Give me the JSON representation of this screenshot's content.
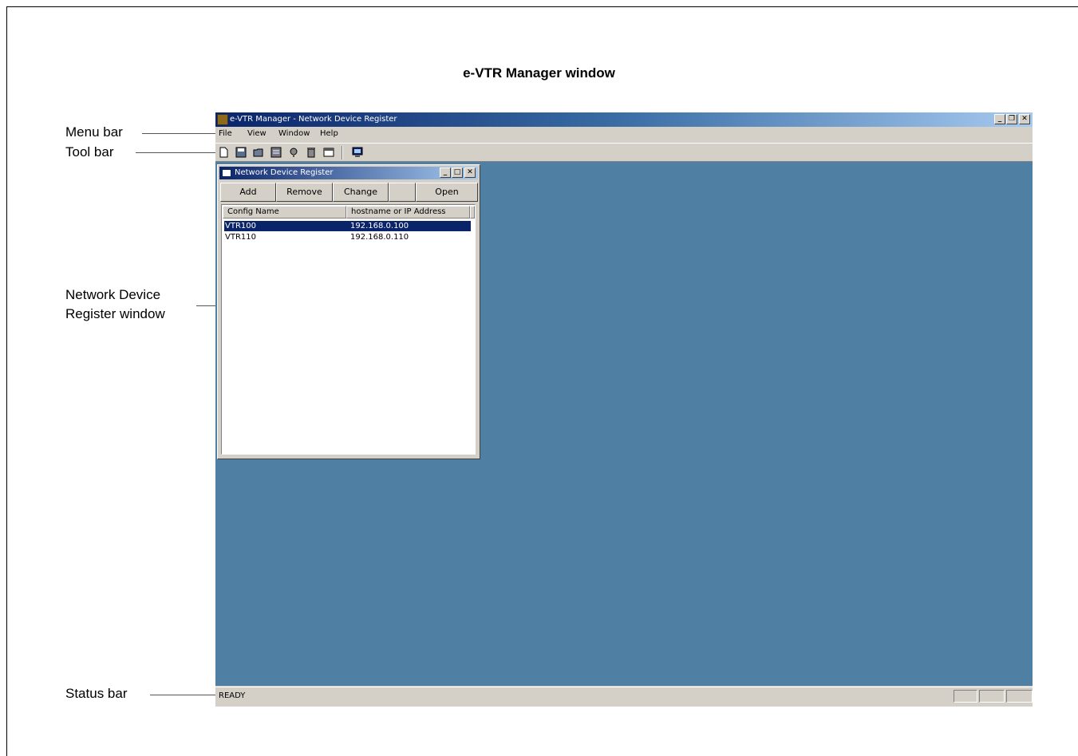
{
  "figure_title": "e-VTR Manager window",
  "callouts": {
    "menu_bar": "Menu bar",
    "tool_bar": "Tool bar",
    "ndr_window_line1": "Network Device",
    "ndr_window_line2": "Register window",
    "status_bar": "Status bar"
  },
  "app": {
    "title": "e-VTR Manager - Network Device Register",
    "window_buttons": {
      "minimize": "_",
      "restore": "❐",
      "close": "✕"
    },
    "menu": [
      "File",
      "View",
      "Window",
      "Help"
    ],
    "toolbar_icons": [
      "new-icon",
      "save-icon",
      "open-folder-icon",
      "list-icon",
      "config-icon",
      "delete-icon",
      "window-icon",
      "monitor-icon"
    ],
    "status": "READY",
    "workspace_color": "#4f7fa2"
  },
  "child_window": {
    "title": "Network Device Register",
    "buttons": [
      "Add",
      "Remove",
      "Change",
      "Open"
    ],
    "columns": [
      "Config Name",
      "hostname or IP Address"
    ],
    "rows": [
      {
        "name": "VTR100",
        "address": "192.168.0.100",
        "selected": true
      },
      {
        "name": "VTR110",
        "address": "192.168.0.110",
        "selected": false
      }
    ]
  }
}
